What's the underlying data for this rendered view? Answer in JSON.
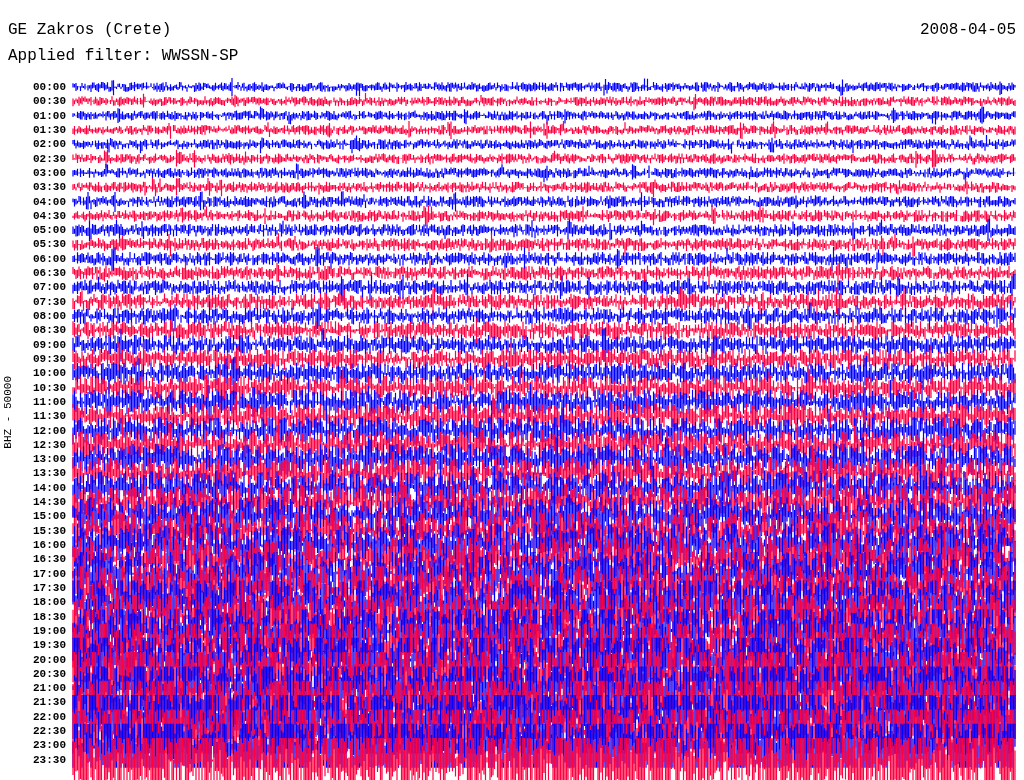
{
  "header": {
    "station": "GE Zakros (Crete)",
    "date": "2008-04-05",
    "filter": "Applied filter: WWSSN-SP"
  },
  "axis_label": "BHZ - 50000",
  "rows": [
    {
      "time": "00:00",
      "color": "#0000ff"
    },
    {
      "time": "00:30",
      "color": "#ff0040"
    },
    {
      "time": "01:00",
      "color": "#0000ff"
    },
    {
      "time": "01:30",
      "color": "#ff0040"
    },
    {
      "time": "02:00",
      "color": "#0000ff"
    },
    {
      "time": "02:30",
      "color": "#ff0040"
    },
    {
      "time": "03:00",
      "color": "#0000ff"
    },
    {
      "time": "03:30",
      "color": "#ff0040"
    },
    {
      "time": "04:00",
      "color": "#0000ff"
    },
    {
      "time": "04:30",
      "color": "#ff0040"
    },
    {
      "time": "05:00",
      "color": "#0000ff"
    },
    {
      "time": "05:30",
      "color": "#ff0040"
    },
    {
      "time": "06:00",
      "color": "#0000ff"
    },
    {
      "time": "06:30",
      "color": "#ff0040"
    },
    {
      "time": "07:00",
      "color": "#0000ff"
    },
    {
      "time": "07:30",
      "color": "#ff0040"
    },
    {
      "time": "08:00",
      "color": "#0000ff"
    },
    {
      "time": "08:30",
      "color": "#ff0040"
    },
    {
      "time": "09:00",
      "color": "#0000ff"
    },
    {
      "time": "09:30",
      "color": "#ff0040"
    },
    {
      "time": "10:00",
      "color": "#0000ff"
    },
    {
      "time": "10:30",
      "color": "#ff0040"
    },
    {
      "time": "11:00",
      "color": "#0000ff"
    },
    {
      "time": "11:30",
      "color": "#ff0040"
    },
    {
      "time": "12:00",
      "color": "#0000ff"
    },
    {
      "time": "12:30",
      "color": "#ff0040"
    },
    {
      "time": "13:00",
      "color": "#0000ff"
    },
    {
      "time": "13:30",
      "color": "#ff0040"
    },
    {
      "time": "14:00",
      "color": "#0000ff"
    },
    {
      "time": "14:30",
      "color": "#ff0040"
    },
    {
      "time": "15:00",
      "color": "#0000ff"
    },
    {
      "time": "15:30",
      "color": "#ff0040"
    },
    {
      "time": "16:00",
      "color": "#0000ff"
    },
    {
      "time": "16:30",
      "color": "#ff0040"
    },
    {
      "time": "17:00",
      "color": "#0000ff"
    },
    {
      "time": "17:30",
      "color": "#ff0040"
    },
    {
      "time": "18:00",
      "color": "#0000ff"
    },
    {
      "time": "18:30",
      "color": "#ff0040"
    },
    {
      "time": "19:00",
      "color": "#0000ff"
    },
    {
      "time": "19:30",
      "color": "#ff0040"
    },
    {
      "time": "20:00",
      "color": "#0000ff"
    },
    {
      "time": "20:30",
      "color": "#ff0040"
    },
    {
      "time": "21:00",
      "color": "#0000ff"
    },
    {
      "time": "21:30",
      "color": "#ff0040"
    },
    {
      "time": "22:00",
      "color": "#0000ff"
    },
    {
      "time": "22:30",
      "color": "#ff0040"
    },
    {
      "time": "23:00",
      "color": "#0000ff"
    },
    {
      "time": "23:30",
      "color": "#ff0040"
    }
  ]
}
